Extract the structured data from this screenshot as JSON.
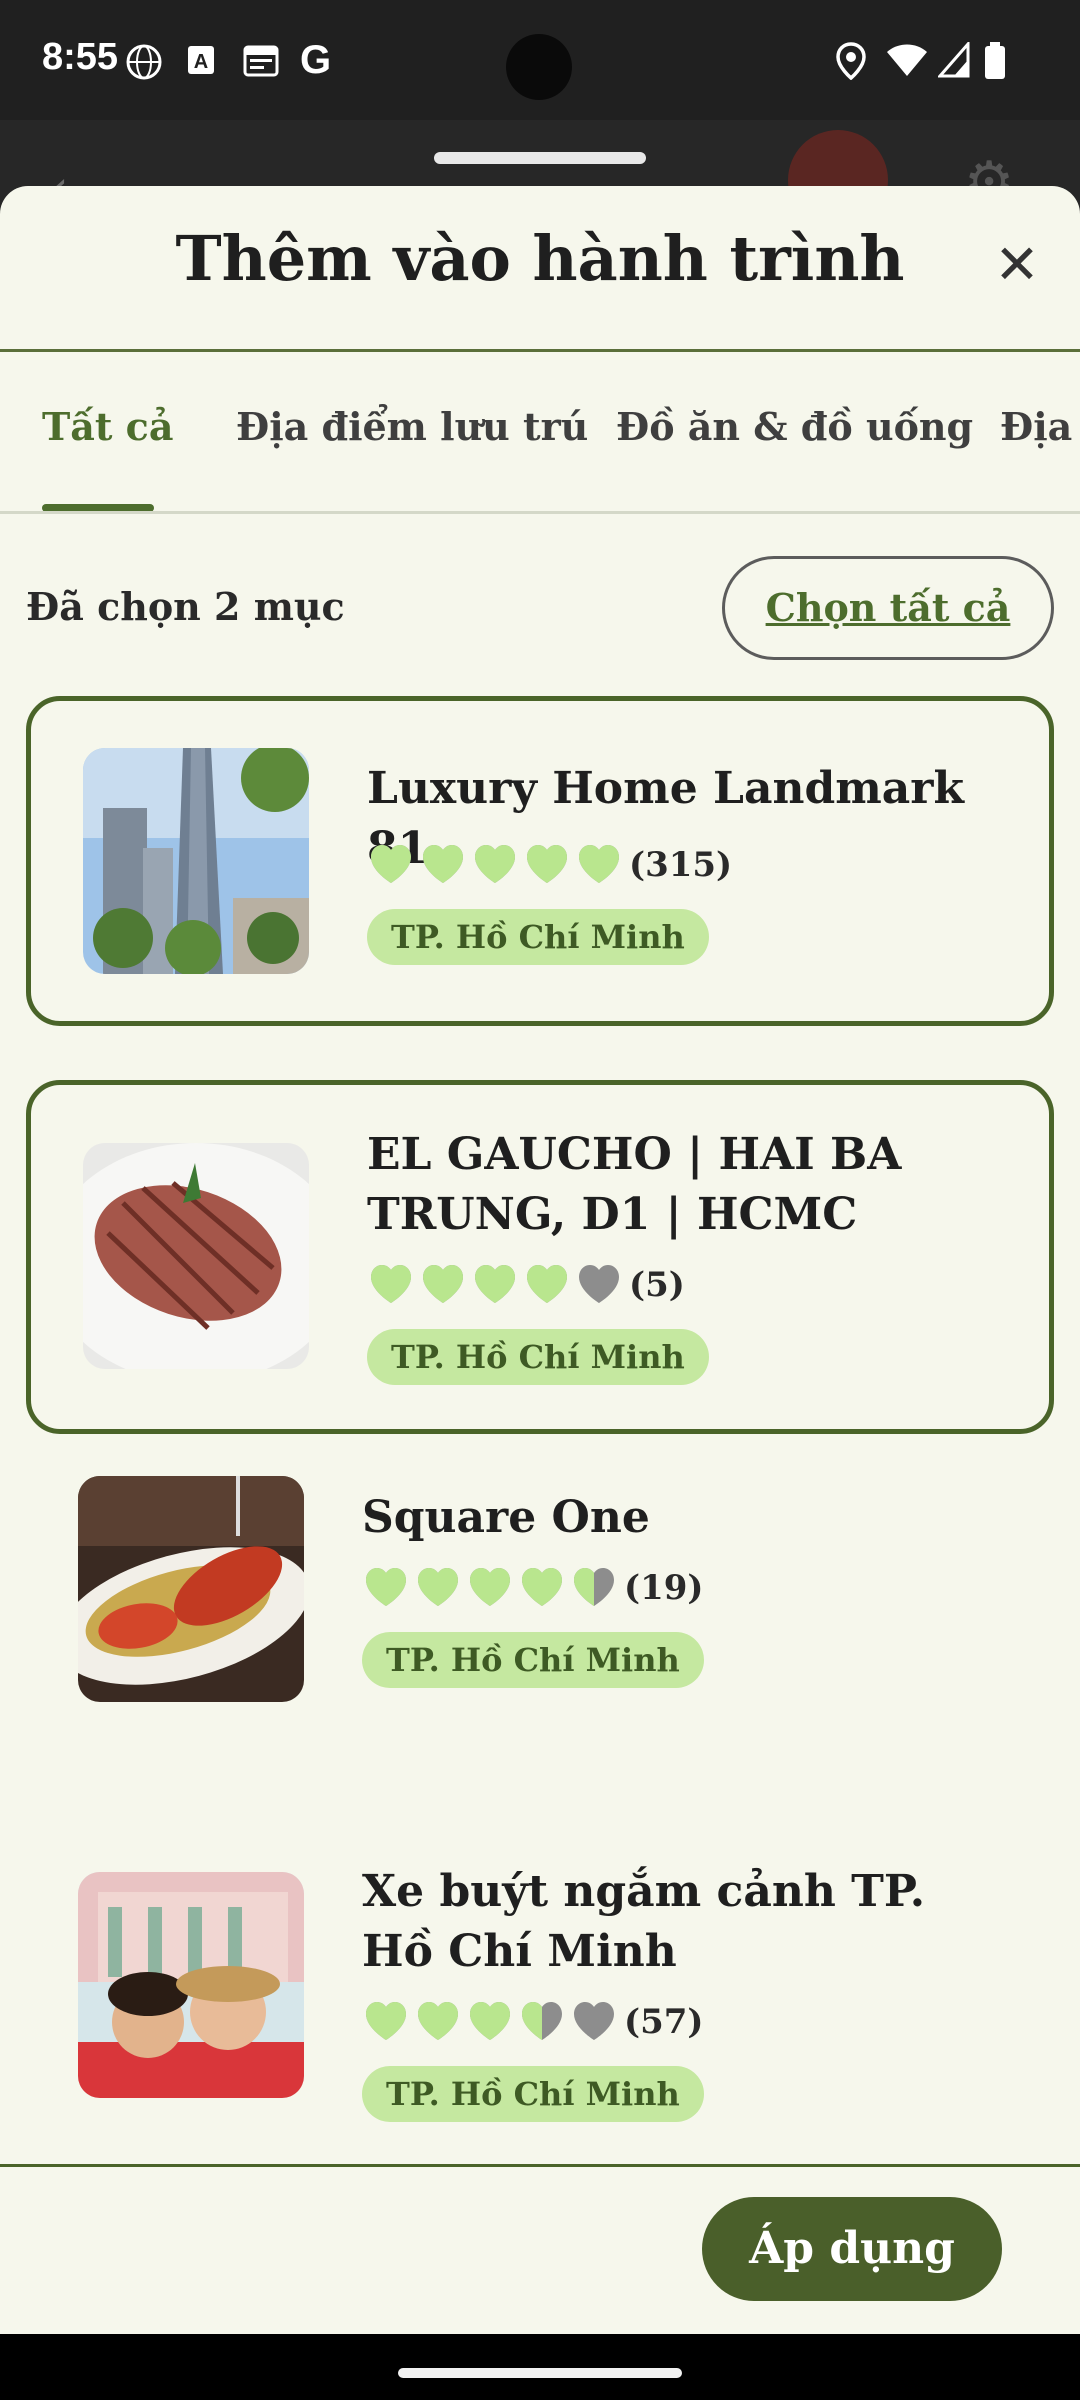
{
  "status_bar": {
    "time": "8:55",
    "left_icons": [
      "globe-icon",
      "a-box-icon",
      "calendar-icon",
      "google-icon"
    ],
    "right_icons": [
      "location-icon",
      "wifi-icon",
      "signal-icon",
      "battery-icon"
    ]
  },
  "sheet": {
    "title": "Thêm vào hành trình",
    "close_glyph": "✕"
  },
  "tabs": [
    {
      "label": "Tất cả",
      "active": true
    },
    {
      "label": "Địa điểm lưu trú",
      "active": false
    },
    {
      "label": "Đồ ăn & đồ uống",
      "active": false
    },
    {
      "label": "Địa điểm tham quan",
      "active": false
    }
  ],
  "selection": {
    "count_text": "Đã chọn 2 mục",
    "select_all_label": "Chọn tất cả"
  },
  "items": [
    {
      "name": "Luxury Home Landmark 81",
      "rating": 5,
      "reviews": "(315)",
      "city": "TP. Hồ Chí Minh",
      "selected": true
    },
    {
      "name": "EL GAUCHO | HAI BA TRUNG, D1 | HCMC",
      "rating": 4,
      "reviews": "(5)",
      "city": "TP. Hồ Chí Minh",
      "selected": true
    },
    {
      "name": "Square One",
      "rating": 4.5,
      "reviews": "(19)",
      "city": "TP. Hồ Chí Minh",
      "selected": false
    },
    {
      "name": "Xe buýt ngắm cảnh TP. Hồ Chí Minh",
      "rating": 3.5,
      "reviews": "(57)",
      "city": "TP. Hồ Chí Minh",
      "selected": false
    }
  ],
  "footer": {
    "apply_label": "Áp dụng"
  },
  "colors": {
    "accent": "#4a6429",
    "heart_filled": "#b9e68e",
    "heart_empty": "#8d8d8d",
    "badge_bg": "#c5e8a0",
    "sheet_bg": "#f6f7ec"
  }
}
